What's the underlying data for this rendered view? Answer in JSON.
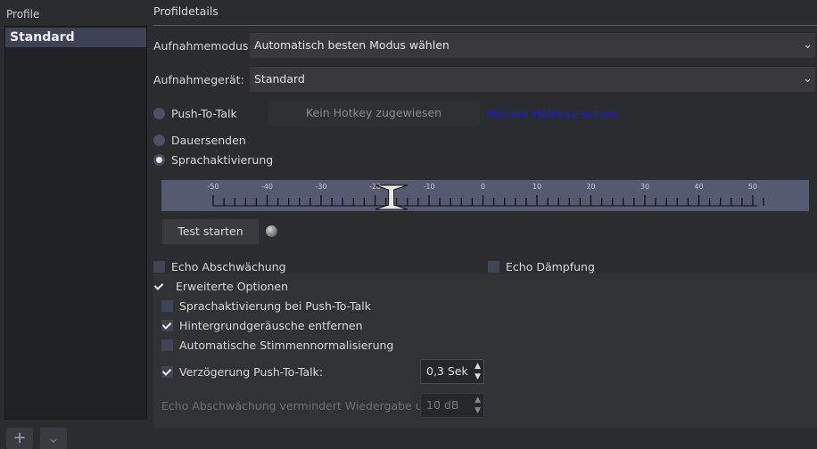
{
  "profiles": {
    "header": "Profile",
    "items": [
      {
        "label": "Standard",
        "selected": true
      }
    ],
    "add_icon": "plus-icon",
    "remove_icon": "chevron-down-icon"
  },
  "details": {
    "title": "Profildetails",
    "capture_mode": {
      "label": "Aufnahmemodus:",
      "value": "Automatisch besten Modus wählen"
    },
    "capture_device": {
      "label": "Aufnahmegerät:",
      "value": "Standard"
    },
    "push_to_talk": {
      "label": "Push-To-Talk",
      "hotkey_button": "Kein Hotkey zugewiesen",
      "more_link": "Weitere Hotkeys setzen",
      "checked": false
    },
    "continuous": {
      "label": "Dauersenden",
      "checked": false
    },
    "voice_activation": {
      "label": "Sprachaktivierung",
      "checked": true
    },
    "meter": {
      "ticks": [
        "-50",
        "-40",
        "-30",
        "-20",
        "-10",
        "0",
        "10",
        "20",
        "30",
        "40",
        "50"
      ],
      "threshold_db": -17
    },
    "test_button": "Test starten",
    "echo_reduction": {
      "label": "Echo Abschwächung",
      "checked": false
    },
    "echo_cancel": {
      "label": "Echo Dämpfung",
      "checked": false
    },
    "advanced": {
      "label": "Erweiterte Optionen",
      "checked": true
    },
    "advanced_options": {
      "va_during_ptt": {
        "label": "Sprachaktivierung bei Push-To-Talk",
        "checked": false
      },
      "remove_noise": {
        "label": "Hintergrundgeräusche entfernen",
        "checked": true
      },
      "auto_normalize": {
        "label": "Automatische Stimmennormalisierung",
        "checked": false
      },
      "ptt_delay": {
        "label": "Verzögerung Push-To-Talk:",
        "value": "0,3 Sek",
        "checked": true
      },
      "echo_reduce_playback": {
        "label": "Echo Abschwächung vermindert Wiedergabe um:",
        "value": "10 dB"
      }
    }
  },
  "colors": {
    "background": "#2b2c2f",
    "accent": "#3d4354",
    "link": "#1919e6",
    "meter": "#555a70"
  }
}
